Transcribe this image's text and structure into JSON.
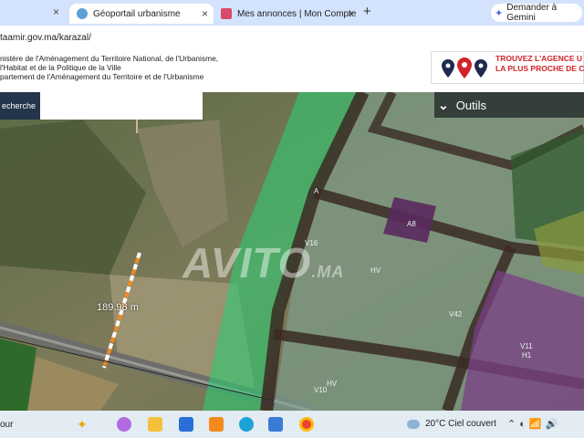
{
  "browser": {
    "tabs": [
      {
        "label": "Géoportail urbanisme",
        "active": true
      },
      {
        "label": "Mes annonces | Mon Compte",
        "active": false
      }
    ],
    "new_tab": "+",
    "gemini": "Demander à Gemini",
    "url": "taamir.gov.ma/karazal/"
  },
  "header": {
    "ministry_lines": [
      "nistère de l'Aménagement du Territoire National, de l'Urbanisme,",
      "l'Habitat et de la Politique de la Ville",
      "partement de l'Aménagement du Territoire et de l'Urbanisme"
    ],
    "promo_lines": [
      "TROUVEZ L'AGENCE U",
      "LA PLUS PROCHE DE C"
    ]
  },
  "map": {
    "search_label": "echerche",
    "tools_label": "Outils",
    "distance": "189.98 m",
    "watermark": "AVITO",
    "watermark_suffix": ".MA",
    "zone_labels": [
      "A",
      "A8",
      "V16",
      "HV",
      "V42",
      "V11",
      "H1",
      "HV",
      "V10"
    ]
  },
  "taskbar": {
    "search_text": "our",
    "weather": "20°C  Ciel couvert"
  },
  "colors": {
    "tabbar": "#d3e3fd",
    "green_zone": "#2ecc71",
    "purple_zone": "#7a3f86",
    "road_zone": "#3a2a22",
    "promo_red": "#d2232a"
  }
}
